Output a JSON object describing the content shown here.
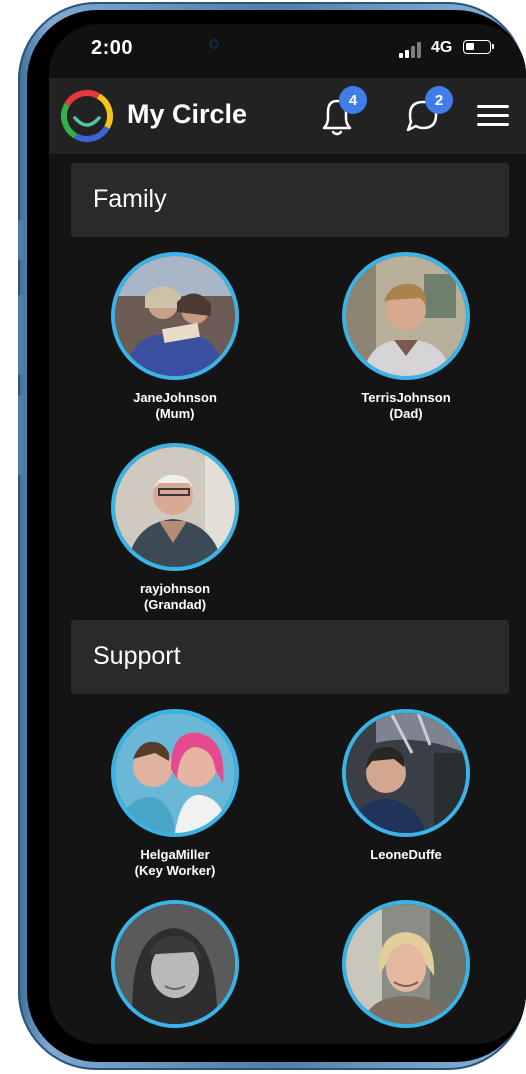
{
  "status_bar": {
    "time": "2:00",
    "network": "4G"
  },
  "header": {
    "title": "My Circle",
    "notifications_count": "4",
    "messages_count": "2"
  },
  "sections": [
    {
      "title": "Family",
      "members": [
        {
          "name": "JaneJohnson",
          "role": "(Mum)"
        },
        {
          "name": "TerrisJohnson",
          "role": "(Dad)"
        },
        {
          "name": "rayjohnson",
          "role": "(Grandad)"
        }
      ]
    },
    {
      "title": "Support",
      "members": [
        {
          "name": "HelgaMiller",
          "role": "(Key Worker)"
        },
        {
          "name": "LeoneDuffe",
          "role": ""
        },
        {
          "name": "",
          "role": ""
        },
        {
          "name": "",
          "role": ""
        }
      ]
    }
  ],
  "colors": {
    "accent_ring": "#3ab4e6",
    "badge": "#3f7ee8",
    "header_bg": "#222222",
    "section_bg": "#2a2a2a",
    "screen_bg": "#141414"
  }
}
